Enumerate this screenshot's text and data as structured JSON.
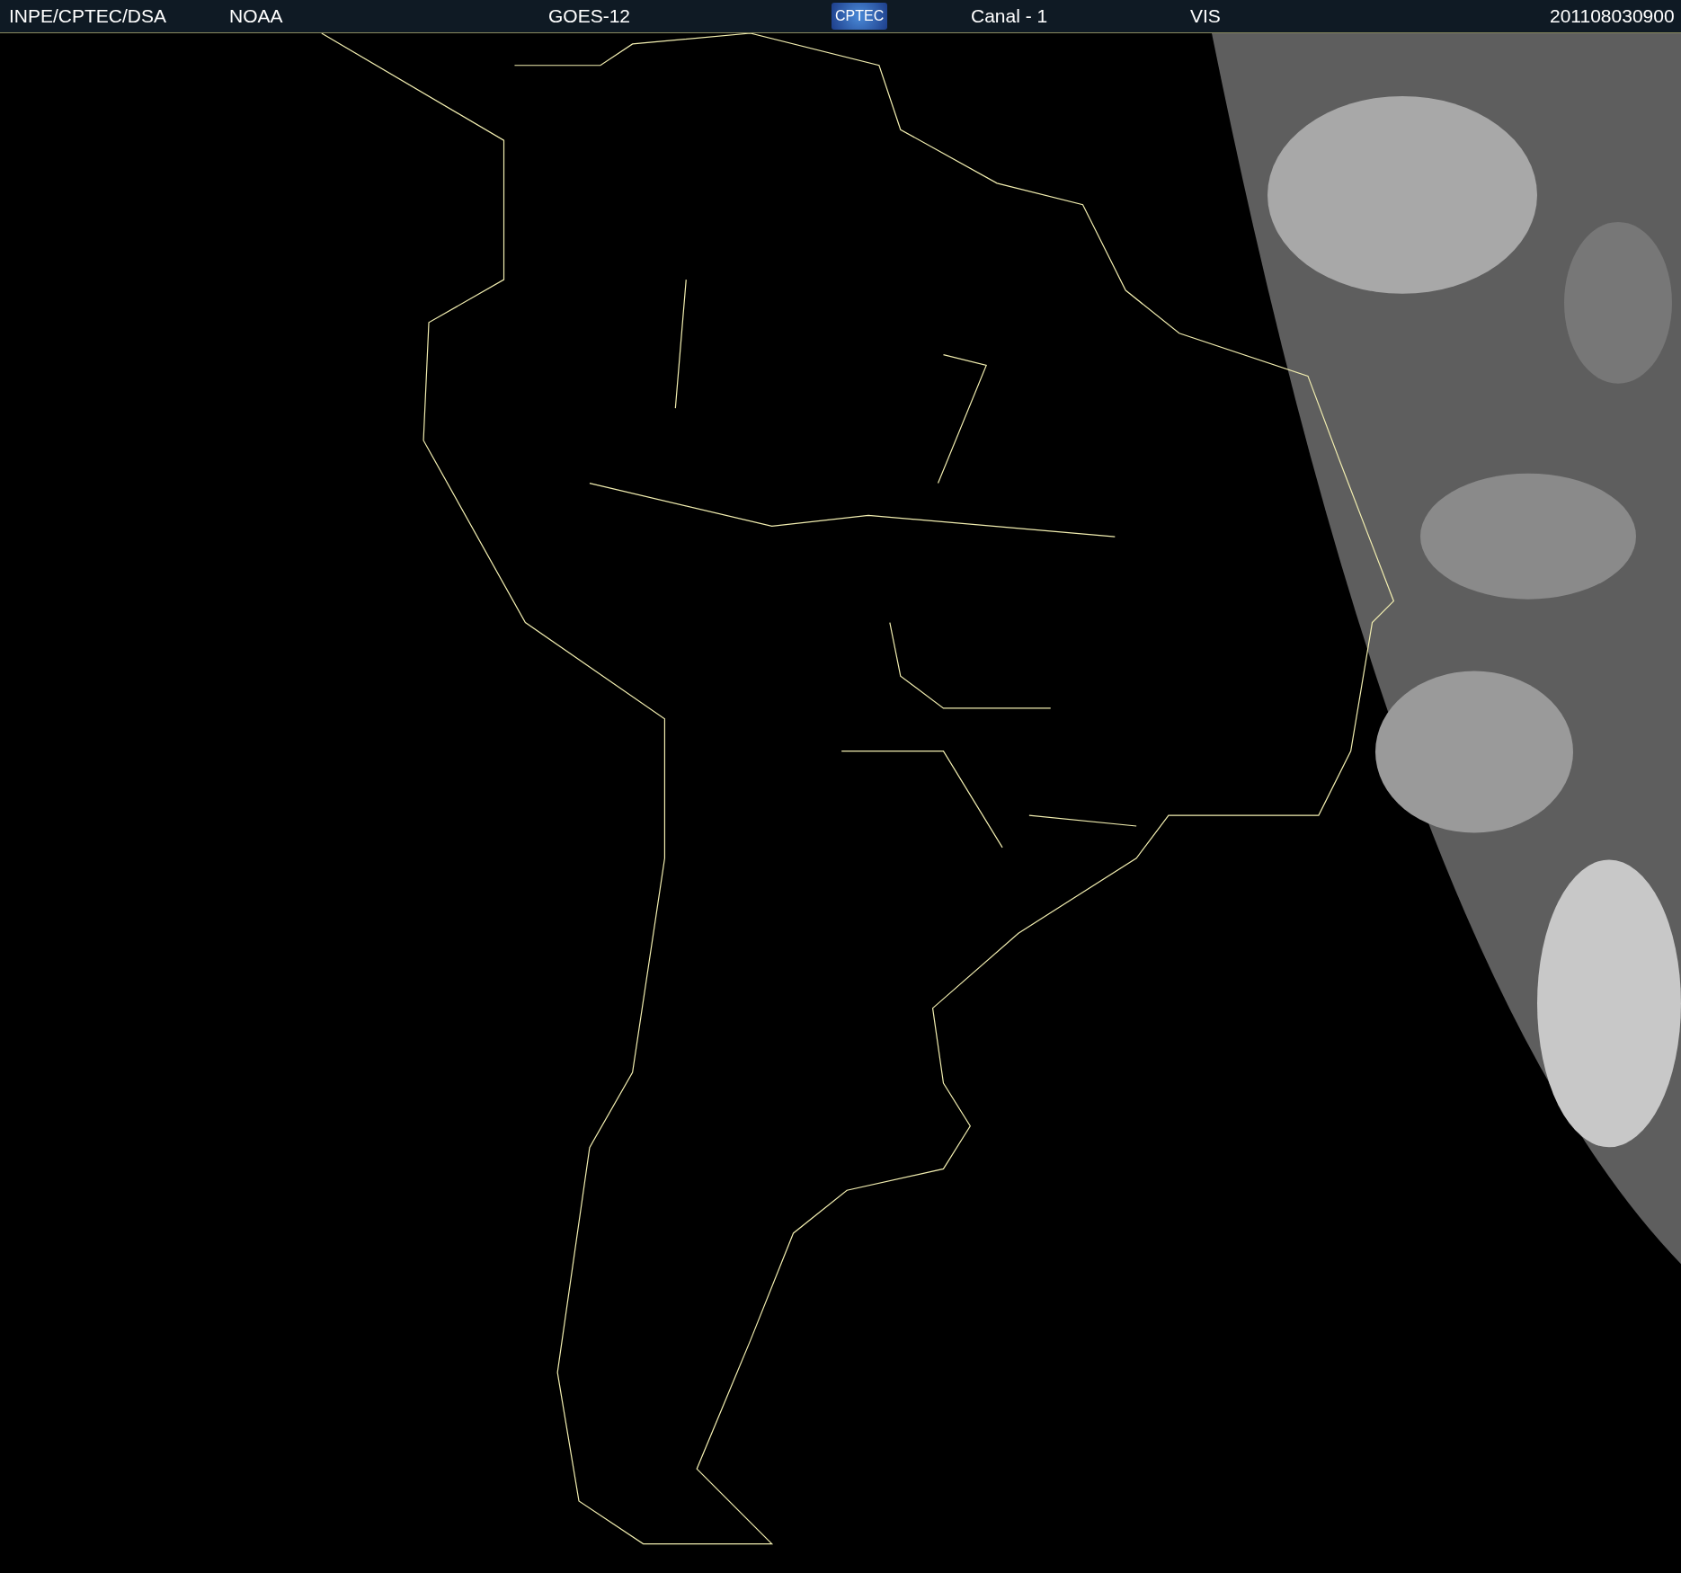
{
  "header": {
    "source": "INPE/CPTEC/DSA",
    "agency": "NOAA",
    "satellite": "GOES-12",
    "logo": "CPTEC",
    "channel": "Canal - 1",
    "band": "VIS",
    "timestamp": "201108030900"
  }
}
